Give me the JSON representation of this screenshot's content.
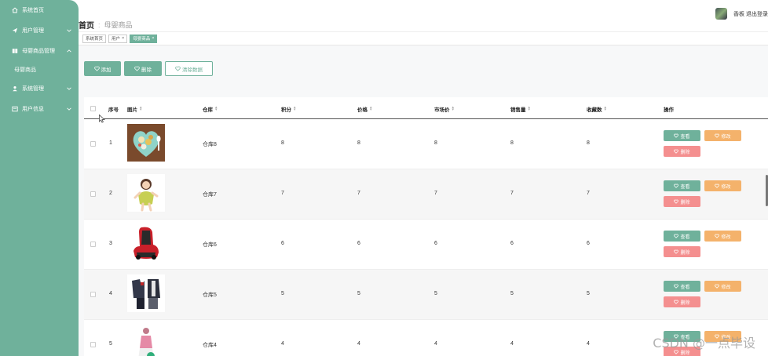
{
  "sidebar": {
    "items": [
      {
        "label": "系统首页",
        "icon": "home-icon"
      },
      {
        "label": "用户管理",
        "icon": "send-icon"
      },
      {
        "label": "母婴商品管理",
        "icon": "book-icon"
      },
      {
        "label": "系统管理",
        "icon": "user-icon"
      },
      {
        "label": "用户信息",
        "icon": "card-icon"
      }
    ],
    "sub_items": [
      {
        "label": "母婴商品"
      }
    ]
  },
  "header": {
    "breadcrumb_home": "首页",
    "breadcrumb_sep": ":",
    "breadcrumb_current": "母婴商品",
    "user_name": "香板",
    "logout_label": "退出登录"
  },
  "tags": [
    {
      "label": "系统首页",
      "closable": false
    },
    {
      "label": "用户",
      "closable": true
    },
    {
      "label": "母婴商品",
      "closable": true
    }
  ],
  "toolbar": {
    "add_label": "添加",
    "delete_label": "删除",
    "clear_label": "清除数据"
  },
  "table": {
    "columns": [
      "序号",
      "图片",
      "仓库",
      "积分",
      "价格",
      "市场价",
      "销售量",
      "收藏数",
      "操作"
    ],
    "rows": [
      {
        "index": "1",
        "image": "fruit-bowl",
        "warehouse": "仓库8",
        "points": "8",
        "price": "8",
        "market_price": "8",
        "sales": "8",
        "favorites": "8"
      },
      {
        "index": "2",
        "image": "baby-figure",
        "warehouse": "仓库7",
        "points": "7",
        "price": "7",
        "market_price": "7",
        "sales": "7",
        "favorites": "7"
      },
      {
        "index": "3",
        "image": "car-seat",
        "warehouse": "仓库6",
        "points": "6",
        "price": "6",
        "market_price": "6",
        "sales": "6",
        "favorites": "6"
      },
      {
        "index": "4",
        "image": "kids-clothes",
        "warehouse": "仓库5",
        "points": "5",
        "price": "5",
        "market_price": "5",
        "sales": "5",
        "favorites": "5"
      },
      {
        "index": "5",
        "image": "baby-doll",
        "warehouse": "仓库4",
        "points": "4",
        "price": "4",
        "market_price": "4",
        "sales": "4",
        "favorites": "4"
      }
    ],
    "actions": {
      "view": "查看",
      "edit": "修改",
      "delete": "删除"
    }
  },
  "watermark": "CSDN @一点毕设",
  "colors": {
    "accent": "#6fb19b",
    "edit": "#f4b26b",
    "danger": "#f48f8f"
  }
}
